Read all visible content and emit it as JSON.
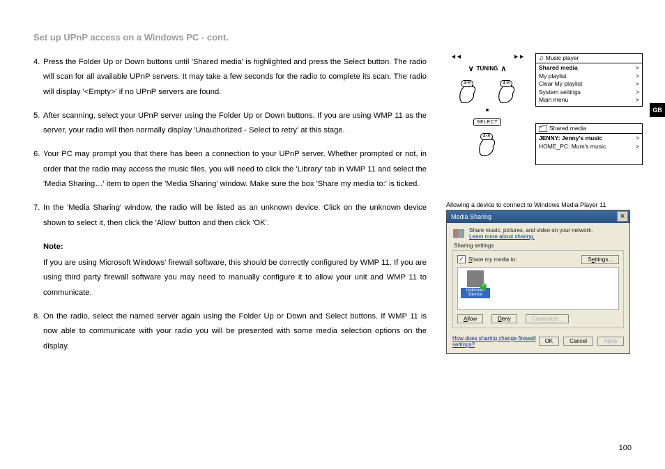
{
  "title": "Set up UPnP access on a Windows PC - cont.",
  "lang_tab": "GB",
  "page_number": "100",
  "steps": {
    "s4": {
      "num": "4.",
      "text": "Press the Folder Up or Down buttons until 'Shared media' is highlighted and press the Select button. The radio will scan for all available UPnP servers. It may take a few seconds for the radio to complete its scan. The radio will display '<Empty>' if no UPnP servers are found."
    },
    "s5": {
      "num": "5.",
      "text": "After scanning, select your UPnP server using the Folder Up or Down buttons. If you are using WMP 11 as the server, your radio will then normally display 'Unauthorized - Select to retry' at this stage."
    },
    "s6": {
      "num": "6.",
      "text": "Your PC may prompt you that there has been a connection to your UPnP server. Whether prompted or not, in order that the radio may access the music files, you will need to click the 'Library' tab in WMP 11 and select the 'Media Sharing…' item to open the 'Media Sharing' window. Make sure the box 'Share my media to:' is ticked."
    },
    "s7": {
      "num": "7.",
      "text": "In the 'Media Sharing' window, the radio will be listed as an unknown device. Click on the unknown device shown to select it, then click the 'Allow' button and then click 'OK'."
    },
    "s8": {
      "num": "8.",
      "text": "On the radio, select the named server again using the Folder Up or Down and Select buttons. If WMP 11 is now able to communicate with your radio you will be presented with some media selection options on the display."
    }
  },
  "note": {
    "label": "Note:",
    "text": "If you are using Microsoft Windows' firewall software, this should be correctly configured by WMP 11. If you are using third party firewall software you may need to manually configure it to allow your unit and WMP 11 to communicate."
  },
  "tuning": {
    "label": "TUNING",
    "hand_label": "4-8",
    "select_label": "SELECT"
  },
  "menu1": {
    "title": "Music player",
    "rows": [
      {
        "label": "Shared media",
        "bold": true
      },
      {
        "label": "My playlist"
      },
      {
        "label": "Clear My playlist"
      },
      {
        "label": "System settings"
      },
      {
        "label": "Main menu"
      }
    ]
  },
  "menu2": {
    "title": "Shared media",
    "rows": [
      {
        "label": "JENNY: Jenny's music",
        "bold": true
      },
      {
        "label": "HOME_PC: Mum's music"
      }
    ]
  },
  "dialog": {
    "caption": "Allowing a device to connect to Windows Media Player 11",
    "title": "Media Sharing",
    "info_line1": "Share music, pictures, and video on your network.",
    "info_link": "Learn more about sharing.",
    "fieldset_label": "Sharing settings",
    "checkbox_label": "Share my media to:",
    "settings_btn": "Settings...",
    "device_label": "Unknown Device",
    "allow_btn": "Allow",
    "deny_btn": "Deny",
    "customize_btn": "Customize...",
    "footer_link": "How does sharing change firewall settings?",
    "ok_btn": "OK",
    "cancel_btn": "Cancel",
    "apply_btn": "Apply"
  }
}
